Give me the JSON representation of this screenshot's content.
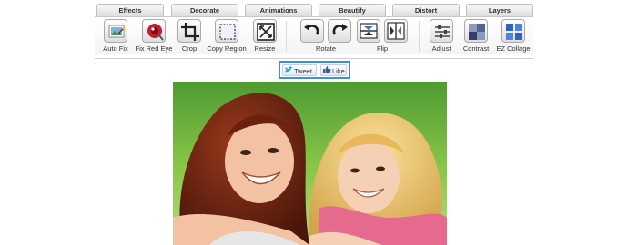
{
  "tabs": [
    "Effects",
    "Decorate",
    "Animations",
    "Beautify",
    "Distort",
    "Layers"
  ],
  "tools": {
    "auto_fix": "Auto Fix",
    "fix_red_eye": "Fix Red Eye",
    "crop": "Crop",
    "copy_region": "Copy Region",
    "resize": "Resize",
    "rotate": "Rotate",
    "flip": "Flip",
    "adjust": "Adjust",
    "contrast": "Contrast",
    "ez_collage": "EZ Collage"
  },
  "social": {
    "tweet": "Tweet",
    "like": "Like"
  },
  "colors": {
    "social_border": "#3f8ed6",
    "red_eye": "#c0202a",
    "grass": "#7fbf3f"
  }
}
